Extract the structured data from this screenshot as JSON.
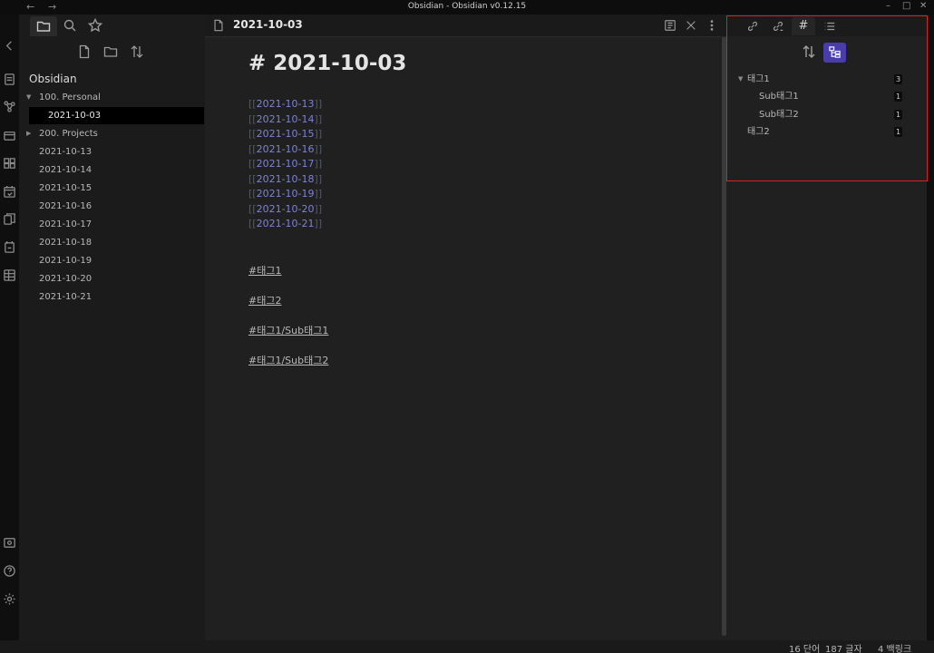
{
  "titlebar": {
    "title": "Obsidian - Obsidian v0.12.15",
    "back": "←",
    "forward": "→",
    "minimize": "–",
    "maximize": "□",
    "close": "✕"
  },
  "ribbon": {
    "icons": [
      "open-quick-switcher-icon",
      "graph-view-icon",
      "open-today-icon",
      "kanban-icon",
      "calendar-icon",
      "templates-icon",
      "daily-note-icon",
      "tables-icon",
      "vault-icon",
      "help-icon",
      "settings-icon"
    ]
  },
  "left": {
    "vault_name": "Obsidian",
    "tree": [
      {
        "label": "100. Personal",
        "type": "folder",
        "expanded": true
      },
      {
        "label": "2021-10-03",
        "type": "file",
        "selected": true
      },
      {
        "label": "200. Projects",
        "type": "folder",
        "expanded": false
      },
      {
        "label": "2021-10-13",
        "type": "file"
      },
      {
        "label": "2021-10-14",
        "type": "file"
      },
      {
        "label": "2021-10-15",
        "type": "file"
      },
      {
        "label": "2021-10-16",
        "type": "file"
      },
      {
        "label": "2021-10-17",
        "type": "file"
      },
      {
        "label": "2021-10-18",
        "type": "file"
      },
      {
        "label": "2021-10-19",
        "type": "file"
      },
      {
        "label": "2021-10-20",
        "type": "file"
      },
      {
        "label": "2021-10-21",
        "type": "file"
      }
    ]
  },
  "editor": {
    "file_title": "2021-10-03",
    "heading": "# 2021-10-03",
    "links": [
      "2021-10-13",
      "2021-10-14",
      "2021-10-15",
      "2021-10-16",
      "2021-10-17",
      "2021-10-18",
      "2021-10-19",
      "2021-10-20",
      "2021-10-21"
    ],
    "link_open": "[[",
    "link_close": "]]",
    "tags": [
      "#태그1",
      "#태그2",
      "#태그1/Sub태그1",
      "#태그1/Sub태그2"
    ]
  },
  "right": {
    "tag_pane": {
      "tags": [
        {
          "label": "태그1",
          "count": "3",
          "expanded": true
        },
        {
          "label": "Sub태그1",
          "count": "1"
        },
        {
          "label": "Sub태그2",
          "count": "1"
        },
        {
          "label": "태그2",
          "count": "1"
        }
      ]
    },
    "hash_symbol": "#"
  },
  "status": {
    "words": "16 단어",
    "chars": "187 글자",
    "backlinks": "4 백링크"
  },
  "colors": {
    "accent": "#4a3dab",
    "link": "#7d82d8",
    "highlight": "#d9202a"
  }
}
